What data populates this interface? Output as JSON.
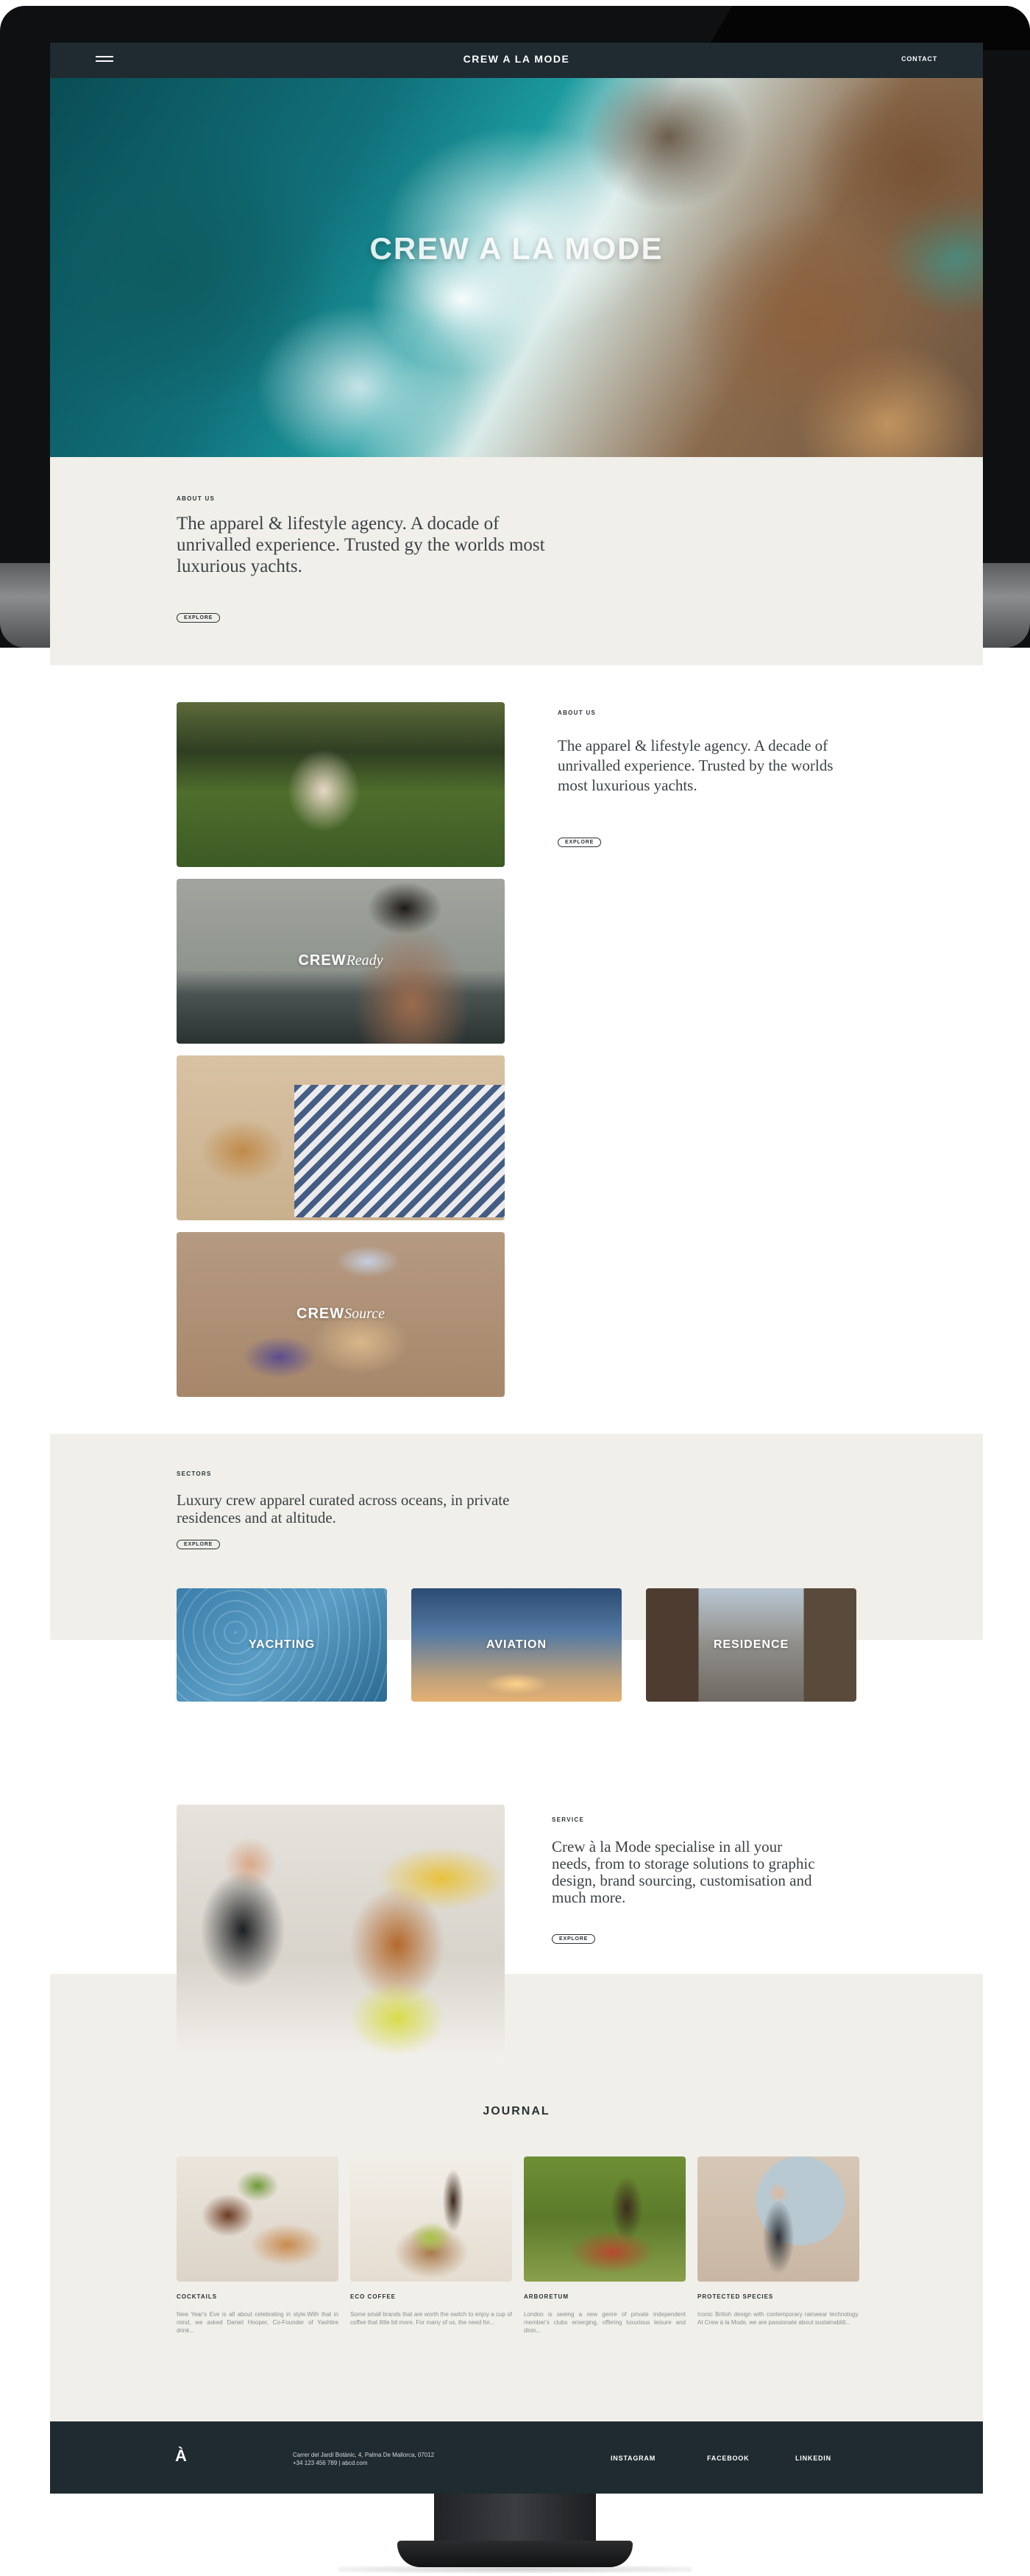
{
  "nav": {
    "brand": "CREW A LA MODE",
    "contact": "CONTACT"
  },
  "hero": {
    "title": "CREW A LA MODE"
  },
  "about_hero": {
    "label": "ABOUT US",
    "text": "The apparel & lifestyle agency. A docade of unrivalled experience. Trusted gy the worlds most luxurious yachts.",
    "button": "EXPLORE"
  },
  "features": {
    "label": "ABOUT US",
    "text": "The apparel & lifestyle agency. A decade of unrivalled experience. Trusted by the worlds most luxurious yachts.",
    "button": "EXPLORE",
    "crew_ready": {
      "bold": "CREW",
      "italic": "Ready"
    },
    "crew_source": {
      "bold": "CREW",
      "italic": "Source"
    }
  },
  "sectors": {
    "label": "SECTORS",
    "text": "Luxury crew apparel curated across oceans, in private residences and at altitude.",
    "button": "EXPLORE",
    "cards": [
      {
        "label": "YACHTING"
      },
      {
        "label": "AVIATION"
      },
      {
        "label": "RESIDENCE"
      }
    ]
  },
  "service": {
    "label": "SERVICE",
    "text": "Crew à la Mode specialise in all your needs, from to storage solutions to graphic design, brand sourcing, customisation and much more.",
    "button": "EXPLORE"
  },
  "journal": {
    "title": "JOURNAL",
    "cards": [
      {
        "title": "COCKTAILS",
        "desc": "New Year's Eve is all about celebrating in style.With that in mind, we asked Daniel Hooper, Co-Founder of Yashtire drink..."
      },
      {
        "title": "ECO COFFEE",
        "desc": "Some small brands that are worth the switch to enjoy a cup of coffee that little bit more. For many of us, the need for..."
      },
      {
        "title": "ARBORETUM",
        "desc": "London is seeing a new genre of private independent member's clubs emerging, offering luxurious leisure and dinin..."
      },
      {
        "title": "PROTECTED SPECIES",
        "desc": "Iconic British design with contemporary rainwear technology. At Crew à la Mode, we are passionate about sustainabilit..."
      }
    ]
  },
  "footer": {
    "logo": "À",
    "address_line1": "Carrer del Jardí Botànic, 4, Palma De Mallorca, 07012",
    "address_line2": "+34 123 456 789 | abcd.com",
    "links": [
      "INSTAGRAM",
      "FACEBOOK",
      "LINKEDIN"
    ]
  },
  "colors": {
    "dark": "#1f2b31",
    "beige": "#f0efea",
    "text": "#2a3135"
  }
}
